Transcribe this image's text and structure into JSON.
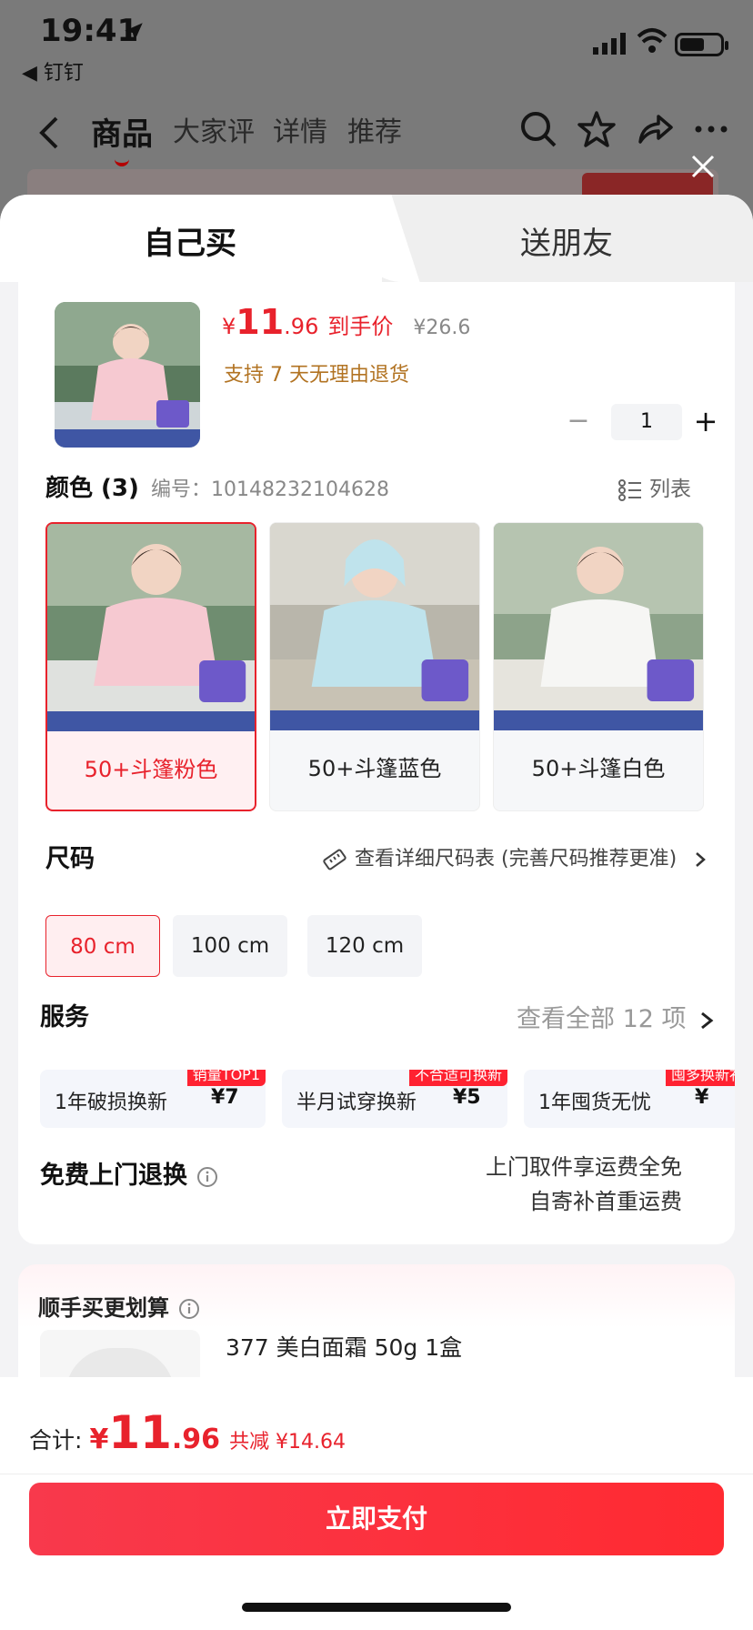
{
  "status_bar": {
    "time": "19:41",
    "back_app": "◀ 钉钉"
  },
  "nav": {
    "tabs": [
      "商品",
      "大家评",
      "详情",
      "推荐"
    ]
  },
  "sheet": {
    "tabs": {
      "self": "自己买",
      "friend": "送朋友"
    },
    "product": {
      "price_symbol": "¥",
      "price_int": "11",
      "price_dec": ".96",
      "price_label": "到手价",
      "original_price": "¥26.6",
      "return_note": "支持 7 天无理由退货",
      "quantity": "1"
    },
    "color": {
      "heading": "颜色 (3)",
      "code": "编号：10148232104628",
      "list_label": "列表",
      "options": [
        {
          "name": "50+斗篷粉色",
          "selected": true,
          "tint": "#f2c8d0"
        },
        {
          "name": "50+斗篷蓝色",
          "selected": false,
          "tint": "#bfe3ec"
        },
        {
          "name": "50+斗篷白色",
          "selected": false,
          "tint": "#f4f4f4"
        }
      ]
    },
    "size": {
      "heading": "尺码",
      "chart_link": "查看详细尺码表 (完善尺码推荐更准)",
      "options": [
        "80 cm",
        "100 cm",
        "120 cm"
      ],
      "selected": "80 cm"
    },
    "service": {
      "heading": "服务",
      "view_all": "查看全部 12 项",
      "items": [
        {
          "name": "1年破损换新",
          "price": "¥7",
          "tag": "销量TOP1"
        },
        {
          "name": "半月试穿换新",
          "price": "¥5",
          "tag": "不合适可换新"
        },
        {
          "name": "1年囤货无忧",
          "price": "¥",
          "tag": "囤多换新补"
        }
      ]
    },
    "free_return": {
      "heading": "免费上门退换",
      "line1": "上门取件享运费全免",
      "line2": "自寄补首重运费"
    },
    "addon": {
      "heading": "顺手买更划算",
      "item_name": "377 美白面霜 50g 1盒"
    }
  },
  "footer": {
    "total_label": "合计:",
    "total_symbol": "¥",
    "total_int": "11",
    "total_dec": ".96",
    "savings": "共减 ¥14.64",
    "pay_button": "立即支付"
  },
  "colors": {
    "accent": "#e8222c",
    "price_note": "#b27322"
  }
}
